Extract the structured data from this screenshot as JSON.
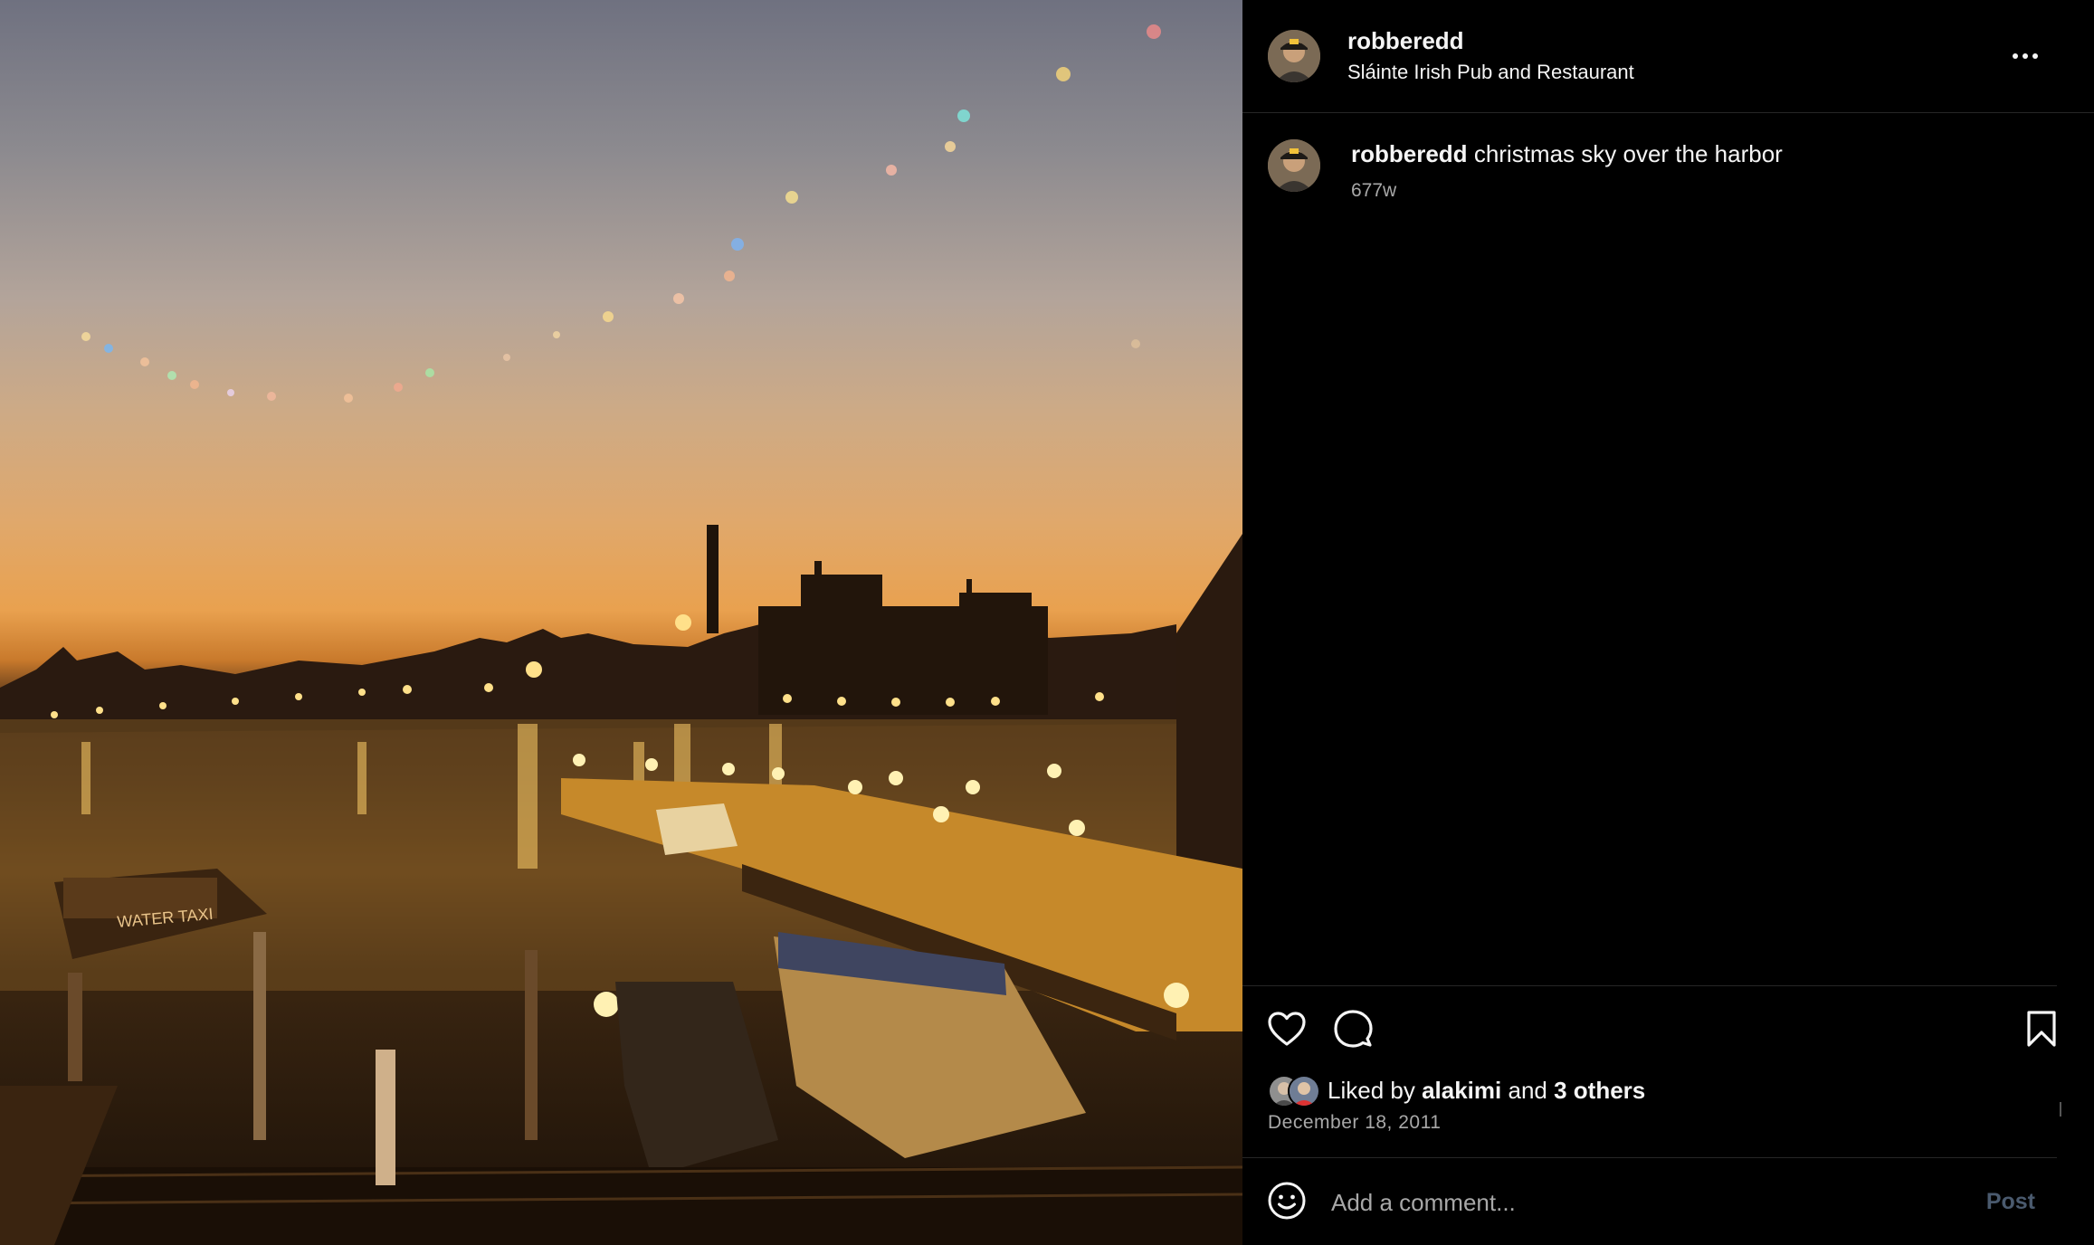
{
  "post": {
    "image_alt": "Harbor at dusk with Water Taxi and lit promenade",
    "photo_sign_text": "WATER TAXI",
    "header": {
      "username": "robberedd",
      "location": "Sláinte Irish Pub and Restaurant",
      "more_icon": "more-horizontal-icon"
    },
    "caption": {
      "username": "robberedd",
      "text": "christmas sky over the harbor",
      "age": "677w"
    },
    "actions": {
      "like_icon": "heart-icon",
      "comment_icon": "comment-icon",
      "save_icon": "bookmark-icon"
    },
    "likes": {
      "prefix": "Liked by",
      "liker": "alakimi",
      "joiner": "and",
      "others": "3 others"
    },
    "date": "December 18, 2011",
    "comment_box": {
      "emoji_icon": "emoji-icon",
      "placeholder": "Add a comment...",
      "post_label": "Post"
    },
    "colors": {
      "background": "#000000",
      "text": "#f5f5f5",
      "secondary_text": "#a8a8a8",
      "divider": "#262626",
      "post_disabled": "#4a5a6e"
    }
  }
}
